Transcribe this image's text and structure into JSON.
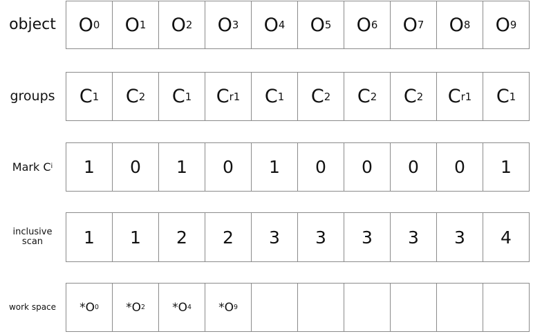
{
  "rows": [
    {
      "id": "object",
      "label": "object",
      "cells": [
        {
          "base": "O",
          "sub": "0"
        },
        {
          "base": "O",
          "sub": "1"
        },
        {
          "base": "O",
          "sub": "2"
        },
        {
          "base": "O",
          "sub": "3"
        },
        {
          "base": "O",
          "sub": "4"
        },
        {
          "base": "O",
          "sub": "5"
        },
        {
          "base": "O",
          "sub": "6"
        },
        {
          "base": "O",
          "sub": "7"
        },
        {
          "base": "O",
          "sub": "8"
        },
        {
          "base": "O",
          "sub": "9"
        }
      ]
    },
    {
      "id": "groups",
      "label": "groups",
      "cells": [
        {
          "base": "C",
          "sub": "1"
        },
        {
          "base": "C",
          "sub": "2"
        },
        {
          "base": "C",
          "sub": "1"
        },
        {
          "base": "C",
          "sub": "r1"
        },
        {
          "base": "C",
          "sub": "1"
        },
        {
          "base": "C",
          "sub": "2"
        },
        {
          "base": "C",
          "sub": "2"
        },
        {
          "base": "C",
          "sub": "2"
        },
        {
          "base": "C",
          "sub": "r1"
        },
        {
          "base": "C",
          "sub": "1"
        }
      ]
    },
    {
      "id": "mark",
      "label": "Mark C",
      "label_sub": "i",
      "cells": [
        {
          "base": "1"
        },
        {
          "base": "0"
        },
        {
          "base": "1"
        },
        {
          "base": "0"
        },
        {
          "base": "1"
        },
        {
          "base": "0"
        },
        {
          "base": "0"
        },
        {
          "base": "0"
        },
        {
          "base": "0"
        },
        {
          "base": "1"
        }
      ]
    },
    {
      "id": "scan",
      "label": "inclusive scan",
      "cells": [
        {
          "base": "1"
        },
        {
          "base": "1"
        },
        {
          "base": "2"
        },
        {
          "base": "2"
        },
        {
          "base": "3"
        },
        {
          "base": "3"
        },
        {
          "base": "3"
        },
        {
          "base": "3"
        },
        {
          "base": "3"
        },
        {
          "base": "4"
        }
      ]
    },
    {
      "id": "workspace",
      "label": "work space",
      "cells": [
        {
          "base": "*O",
          "sub": "0"
        },
        {
          "base": "*O",
          "sub": "2"
        },
        {
          "base": "*O",
          "sub": "4"
        },
        {
          "base": "*O",
          "sub": "9"
        },
        {
          "base": ""
        },
        {
          "base": ""
        },
        {
          "base": ""
        },
        {
          "base": ""
        },
        {
          "base": ""
        },
        {
          "base": ""
        }
      ]
    }
  ]
}
